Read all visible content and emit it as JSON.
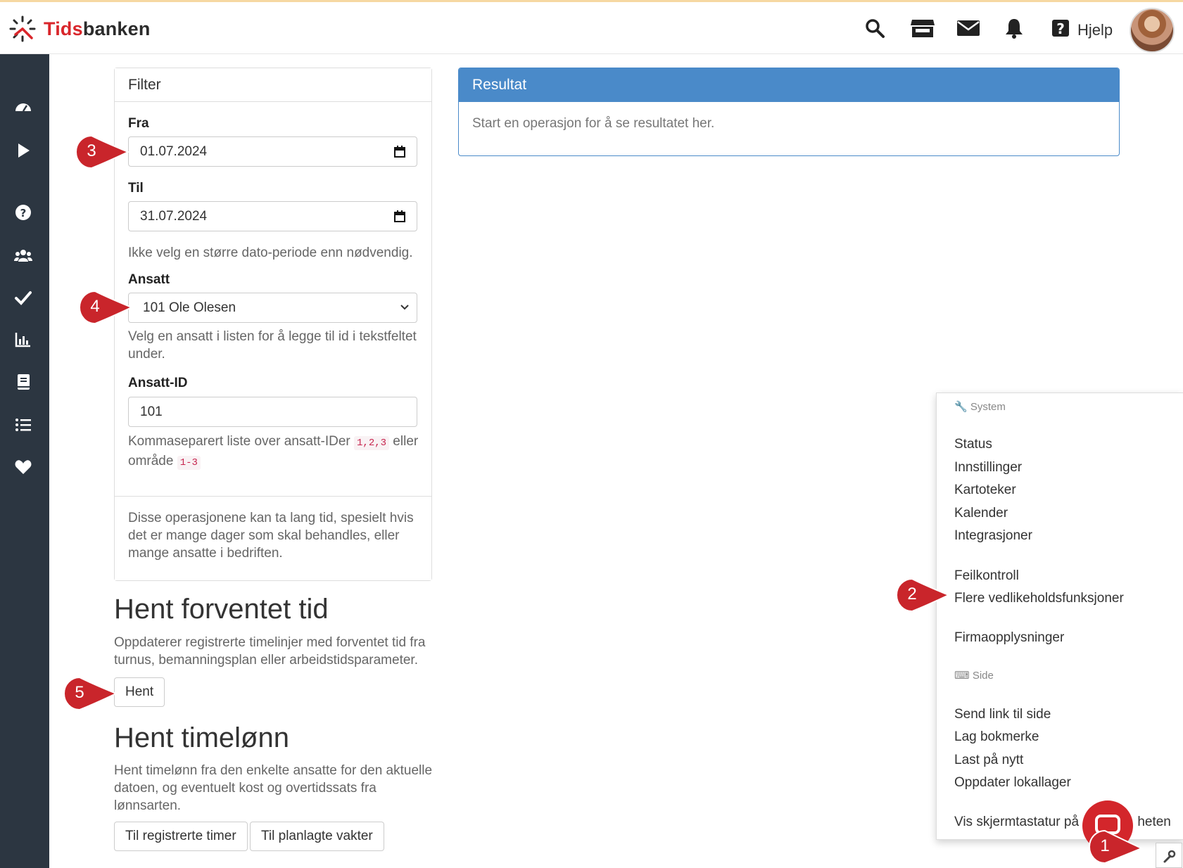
{
  "app": {
    "brand_a": "Tids",
    "brand_b": "banken"
  },
  "topbar": {
    "help_label": "Hjelp"
  },
  "filter": {
    "title": "Filter",
    "from_label": "Fra",
    "from_value": "01.07.2024",
    "to_label": "Til",
    "to_value": "31.07.2024",
    "period_hint": "Ikke velg en større dato-periode enn nødvendig.",
    "employee_label": "Ansatt",
    "employee_value": "101 Ole Olesen",
    "employee_hint": "Velg en ansatt i listen for å legge til id i tekstfeltet under.",
    "employee_id_label": "Ansatt-ID",
    "employee_id_value": "101",
    "id_hint_a": "Kommaseparert liste over ansatt-IDer ",
    "id_hint_code_a": "1,2,3",
    "id_hint_b": " eller område ",
    "id_hint_code_b": "1-3",
    "footer_text": "Disse operasjonene kan ta lang tid, spesielt hvis det er mange dager som skal behandles, eller mange ansatte i bedriften."
  },
  "result": {
    "title": "Resultat",
    "body": "Start en operasjon for å se resultatet her."
  },
  "section1": {
    "title": "Hent forventet tid",
    "text": "Oppdaterer registrerte timelinjer med forventet tid fra turnus, bemanningsplan eller arbeidstidsparameter.",
    "button": "Hent"
  },
  "section2": {
    "title": "Hent timelønn",
    "text": "Hent timelønn fra den enkelte ansatte for den aktuelle datoen, og eventuelt kost og overtidssats fra lønnsarten.",
    "button_a": "Til registrerte timer",
    "button_b": "Til planlagte vakter"
  },
  "menu": {
    "system_header": "System",
    "items_system": [
      "Status",
      "Innstillinger",
      "Kartoteker",
      "Kalender",
      "Integrasjoner"
    ],
    "items_maint": [
      "Feilkontroll",
      "Flere vedlikeholdsfunksjoner"
    ],
    "item_company": "Firmaopplysninger",
    "side_header": "Side",
    "items_side": [
      "Send link til side",
      "Lag bokmerke",
      "Last på nytt",
      "Oppdater lokallager"
    ],
    "item_keyboard_a": "Vis skjermtastatur på ",
    "item_keyboard_b": "heten"
  },
  "callouts": [
    "1",
    "2",
    "3",
    "4",
    "5"
  ],
  "colors": {
    "brand_red": "#d9262b",
    "sidebar": "#2c3641",
    "result_blue": "#4a8ac9",
    "callout_red": "#c9252b"
  },
  "icons": [
    "search-icon",
    "store-icon",
    "mail-icon",
    "bell-icon",
    "help-icon",
    "dashboard-icon",
    "play-icon",
    "question-icon",
    "users-icon",
    "check-icon",
    "chart-icon",
    "book-icon",
    "list-icon",
    "heart-icon",
    "wrench-icon",
    "keyboard-icon",
    "calendar-icon",
    "chevron-down-icon"
  ]
}
